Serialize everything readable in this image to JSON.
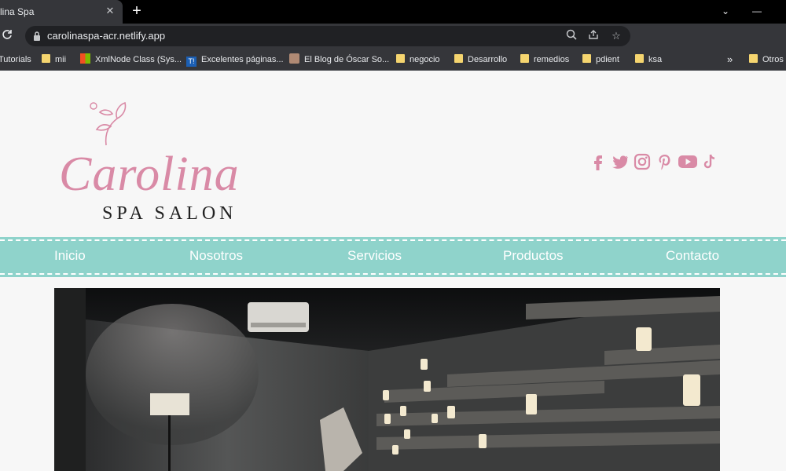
{
  "browser": {
    "tab_title": "lina Spa",
    "url": "carolinaspa-acr.netlify.app",
    "bookmarks": [
      {
        "label": "Tutorials",
        "icon": "folder"
      },
      {
        "label": "mii",
        "icon": "folder"
      },
      {
        "label": "XmlNode Class (Sys...",
        "icon": "microsoft-icon"
      },
      {
        "label": "Excelentes páginas...",
        "icon": "ti-icon"
      },
      {
        "label": "El Blog de Óscar So...",
        "icon": "avatar-icon"
      },
      {
        "label": "negocio",
        "icon": "folder"
      },
      {
        "label": "Desarrollo",
        "icon": "folder"
      },
      {
        "label": "remedios",
        "icon": "folder"
      },
      {
        "label": "pdient",
        "icon": "folder"
      },
      {
        "label": "ksa",
        "icon": "folder"
      }
    ],
    "overflow": "»",
    "other_bookmarks": "Otros"
  },
  "site": {
    "logo_script": "Carolina",
    "logo_sub": "SPA SALON",
    "nav": [
      "Inicio",
      "Nosotros",
      "Servicios",
      "Productos",
      "Contacto"
    ],
    "social_icons": [
      "facebook-icon",
      "twitter-icon",
      "instagram-icon",
      "pinterest-icon",
      "youtube-icon",
      "tiktok-icon"
    ],
    "colors": {
      "accent": "#d98aa6",
      "nav": "#8fd3cb"
    }
  }
}
